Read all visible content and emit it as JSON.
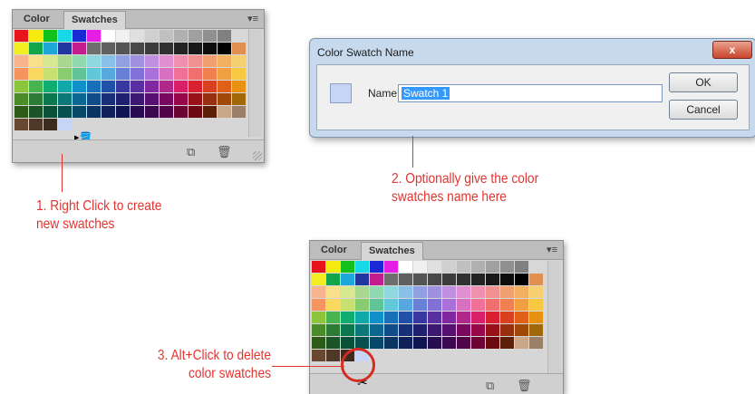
{
  "panel_top": {
    "tabs": [
      {
        "label": "Color"
      },
      {
        "label": "Swatches"
      }
    ],
    "menu_icon": "panel-menu-icon"
  },
  "panel_bottom": {
    "tabs": [
      {
        "label": "Color"
      },
      {
        "label": "Swatches"
      }
    ],
    "menu_icon": "panel-menu-icon"
  },
  "swatch_rows": [
    [
      "#e8141b",
      "#f7ea0e",
      "#14c11c",
      "#17d8e6",
      "#1b29d4",
      "#e51ee3",
      "#ffffff",
      "#f0f0f0",
      "#e0e0e0",
      "#d0d0d0",
      "#c0c0c0",
      "#b0b0b0",
      "#a0a0a0",
      "#909090",
      "#808080",
      "#d8d8d8",
      "#e61c25"
    ],
    [
      "#f2ee22",
      "#13a54a",
      "#1ea7d9",
      "#22369f",
      "#c41c8c",
      "#6e6e6e",
      "#606060",
      "#545454",
      "#484848",
      "#3c3c3c",
      "#303030",
      "#242424",
      "#181818",
      "#0c0c0c",
      "#000000",
      "#e09050",
      "#f09060"
    ],
    [
      "#f8b48c",
      "#fbe08c",
      "#d8e890",
      "#a8d890",
      "#90d8b0",
      "#90d8e0",
      "#88c0e8",
      "#90a0e0",
      "#a090e0",
      "#c090e0",
      "#e090d0",
      "#f090b0",
      "#f09090",
      "#f0a070",
      "#f0b060",
      "#f6d070",
      "#e8c050"
    ],
    [
      "#f69460",
      "#fad860",
      "#c8e070",
      "#88cc70",
      "#60c498",
      "#60c8d8",
      "#58a8e0",
      "#6880d8",
      "#8070d8",
      "#a870d8",
      "#d870c0",
      "#f07098",
      "#f07070",
      "#f08050",
      "#f0a040",
      "#f8c840",
      "#f2e628"
    ],
    [
      "#8cc43c",
      "#48b450",
      "#10ac70",
      "#10a8a8",
      "#1090c8",
      "#1870b8",
      "#2050a8",
      "#3838a0",
      "#5830a0",
      "#8028a0",
      "#b02888",
      "#d82068",
      "#d82030",
      "#d84020",
      "#e06018",
      "#e89010",
      "#b89018"
    ],
    [
      "#4c8c28",
      "#2c7c38",
      "#0c7850",
      "#0c7878",
      "#0c6890",
      "#104c88",
      "#183078",
      "#202070",
      "#3c1870",
      "#581070",
      "#780860",
      "#980848",
      "#981018",
      "#983010",
      "#a04808",
      "#a06808",
      "#807010"
    ],
    [
      "#2c5c18",
      "#1c5428",
      "#085038",
      "#085050",
      "#084868",
      "#0c3460",
      "#102058",
      "#101450",
      "#280c50",
      "#3c0850",
      "#520448",
      "#6c0434",
      "#6c0810",
      "#5c2008",
      "#c8a888",
      "#9a8068",
      "#7c6450"
    ],
    [
      "#684830",
      "#503828",
      "#3c2c20",
      "#c6d4f5"
    ]
  ],
  "dialog": {
    "title": "Color Swatch Name",
    "close_label": "x",
    "name_label": "Name:",
    "name_value": "Swatch 1",
    "ok_label": "OK",
    "cancel_label": "Cancel"
  },
  "annotations": {
    "step1": [
      "1. Right Click to create",
      "new swatches"
    ],
    "step2": [
      "2. Optionally give the color",
      "swatches name here"
    ],
    "step3": [
      "3. Alt+Click to delete",
      "color swatches"
    ]
  },
  "colors": {
    "annotation": "#e3342f",
    "panel_bg": "#d6d6d6",
    "dialog_frame": "#c7d9ec"
  }
}
